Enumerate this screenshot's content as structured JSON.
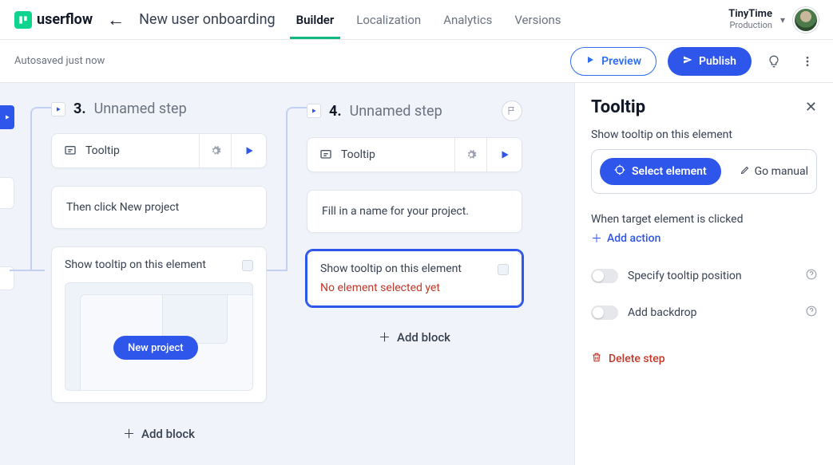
{
  "product": "userflow",
  "flow_name": "New user onboarding",
  "tabs": [
    "Builder",
    "Localization",
    "Analytics",
    "Versions"
  ],
  "active_tab": 0,
  "environment": {
    "name": "TinyTime",
    "kind": "Production"
  },
  "autosave": "Autosaved just now",
  "actions": {
    "preview": "Preview",
    "publish": "Publish"
  },
  "steps": [
    {
      "index": 3,
      "title": "Unnamed step",
      "type_label": "Tooltip",
      "content": "Then click New project",
      "target_label": "Show tooltip on this element",
      "preview_button": "New project",
      "add_block": "Add block"
    },
    {
      "index": 4,
      "title": "Unnamed step",
      "type_label": "Tooltip",
      "content": "Fill in a name for your project.",
      "target_label": "Show tooltip on this element",
      "target_error": "No element selected yet",
      "add_block": "Add block"
    }
  ],
  "sidepanel": {
    "title": "Tooltip",
    "target_label": "Show tooltip on this element",
    "select_element": "Select element",
    "go_manual": "Go manual",
    "clicked_label": "When target element is clicked",
    "add_action": "Add action",
    "option_position": "Specify tooltip position",
    "option_backdrop": "Add backdrop",
    "delete": "Delete step"
  }
}
